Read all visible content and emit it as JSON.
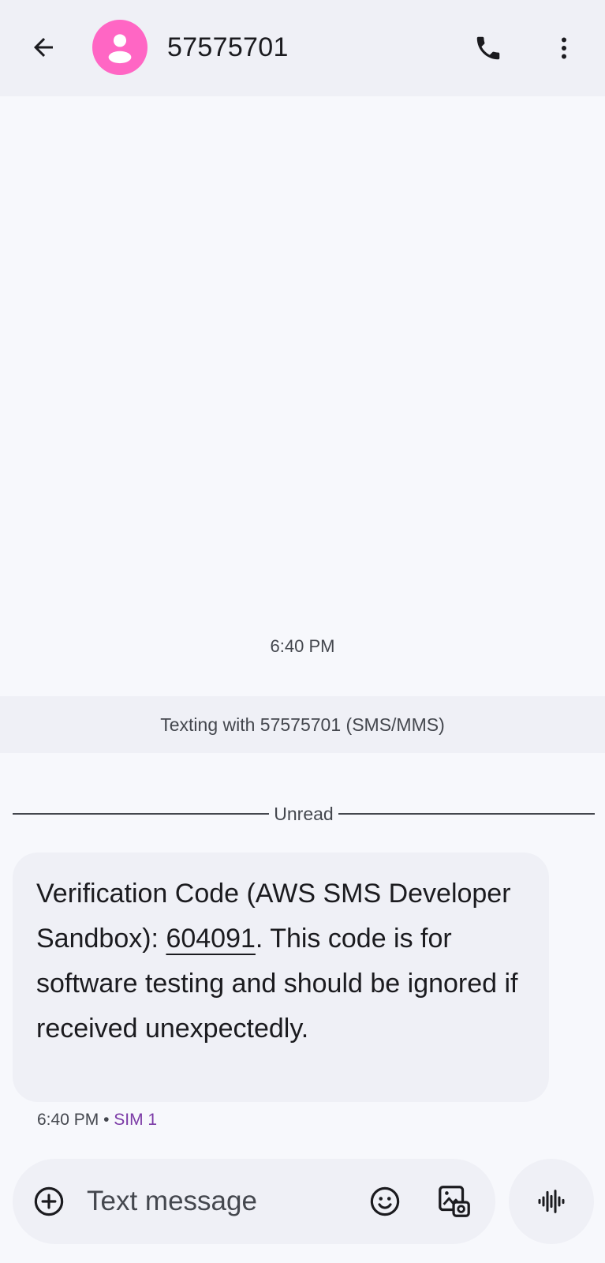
{
  "header": {
    "contact_name": "57575701",
    "avatar_color": "#ff66c4",
    "icons": {
      "back": "arrow-back-icon",
      "avatar": "person-icon",
      "call": "phone-icon",
      "more": "more-vert-icon"
    }
  },
  "conversation": {
    "time_header": "6:40 PM",
    "texting_banner": "Texting with 57575701 (SMS/MMS)",
    "unread_label": "Unread",
    "messages": [
      {
        "text_before_code": "Verification Code (AWS SMS Developer Sandbox): ",
        "code": "604091",
        "text_after_code": ". This code is for software testing and should be ignored if received unexpectedly.",
        "time": "6:40 PM",
        "separator": "•",
        "sim": "SIM 1",
        "sim_color": "#7b3aa6"
      }
    ]
  },
  "compose": {
    "placeholder": "Text message",
    "icons": {
      "add": "add-circle-icon",
      "emoji": "emoji-icon",
      "gallery": "gallery-icon",
      "voice": "voice-waveform-icon"
    }
  }
}
